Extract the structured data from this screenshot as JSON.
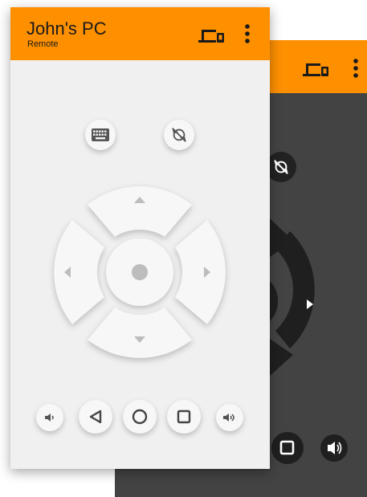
{
  "app": {
    "title": "John's PC",
    "subtitle": "Remote"
  },
  "colors": {
    "accent": "#fe9000",
    "light_background": "#f0f0f0",
    "dark_background": "#434343",
    "icon_dark": "#222222"
  },
  "header": {
    "devices_icon": "devices-icon",
    "menu_icon": "more-vert-icon"
  },
  "controls": {
    "keyboard": "keyboard-icon",
    "sync": "sync-disabled-icon",
    "dpad": [
      "dpad-up",
      "dpad-left",
      "dpad-right",
      "dpad-down",
      "dpad-ok"
    ],
    "volume_down": "volume-down-icon",
    "back": "back-triangle-icon",
    "home": "home-circle-icon",
    "recents": "recents-square-icon",
    "volume_up": "volume-up-icon"
  }
}
